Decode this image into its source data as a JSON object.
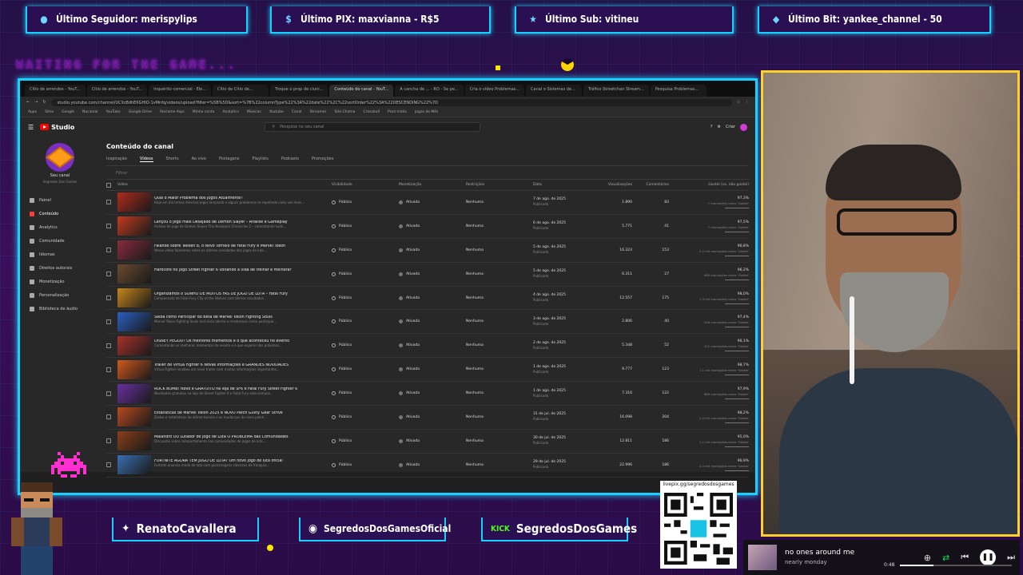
{
  "overlay": {
    "alerts": [
      {
        "icon": "user-icon",
        "text": "Último Seguidor: merispylips"
      },
      {
        "icon": "dollar-icon",
        "text": "Último PIX: maxvianna - R$5"
      },
      {
        "icon": "star-icon",
        "text": "Último Sub: vitineu"
      },
      {
        "icon": "diamond-icon",
        "text": "Último Bit: yankee_channel - 50"
      }
    ],
    "waiting": "WAITING FOR THE GAME...",
    "accent": "#1ad0ff",
    "cam_border": "#ffd02a"
  },
  "browser": {
    "tabs": [
      "Cítio de arrendos - YouT...",
      "Cítio de arrendos - YouT...",
      "Inquérito comercial - Ele...",
      "Cítio de Cítio de...",
      "Troque o prop de ciuni...",
      "Conteúdo do canal - YouT...",
      "A cancha de ... - RO - Se pe...",
      "Cria o vídeo Problemas...",
      "Canal o Sistemas de...",
      "Tráfico Streetchan Stream...",
      "Pesquisa Problemas..."
    ],
    "active_tab": 5,
    "url": "studio.youtube.com/channel/UCXz8dhEKGHIO-1vMnfq/videos/upload?filter=%5B%5D&sort=%7B%22columnType%22%3A%22date%22%2C%22sortOrder%22%3A%22DESCENDING%22%7D",
    "bookmarks": [
      "Apps",
      "Sites",
      "Google",
      "Nacional",
      "YouTube",
      "Google Drive",
      "Reclame Aqui",
      "Minha conta",
      "Analytics",
      "Músicas",
      "Youtube",
      "Canal",
      "Streamer",
      "Site Chama",
      "Crossbull",
      "Prod mídia",
      "Jogos do Mês"
    ]
  },
  "studio": {
    "logo": "Studio",
    "search_placeholder": "Pesquise no seu canal",
    "create_label": "Criar",
    "channel_name": "Seu canal",
    "channel_sub": "Segredos Dos Games",
    "sidebar": [
      "Painel",
      "Conteúdo",
      "Analytics",
      "Comunidade",
      "Idiomas",
      "Direitos autorais",
      "Monetização",
      "Personalização",
      "Biblioteca de áudio"
    ],
    "sidebar_active": 1,
    "page_title": "Conteúdo do canal",
    "tabs": [
      "Inspiração",
      "Vídeos",
      "Shorts",
      "Ao vivo",
      "Postagens",
      "Playlists",
      "Podcasts",
      "Promoções"
    ],
    "tabs_active": 1,
    "filter": "Filtrar",
    "columns": [
      "Vídeo",
      "Visibilidade",
      "Monetização",
      "Restrições",
      "Data",
      "Visualizações",
      "Comentários",
      "Gostei (vs. não gostei)"
    ],
    "rows": [
      {
        "title": "Qual o Maior Problema dos Jogos Atualmente?",
        "desc": "Hoje em dia temos diversos jogos lançando e alguns problemas se repetindo cada vez mais...",
        "vis": "Público",
        "mon": "Ativada",
        "res": "Nenhuma",
        "date": "7 de ago. de 2025",
        "status": "Publicado",
        "views": "1.890",
        "comments": "83",
        "like": "97,3%",
        "likes": "7 marcações como 'Gostei'",
        "thumb": "#b02a1c"
      },
      {
        "title": "Lançou o Jogo mais Desejado de Demon Slayer – Análise e Gameplay",
        "desc": "Análise do jogo de Demon Slayer The Hinokami Chronicles 2 – comentando tudo...",
        "vis": "Público",
        "mon": "Ativada",
        "res": "Nenhuma",
        "date": "6 de ago. de 2025",
        "status": "Publicado",
        "views": "5.771",
        "comments": "41",
        "like": "97,5%",
        "likes": "7 marcações como 'Gostei'",
        "thumb": "#c23b1f"
      },
      {
        "title": "Falando sobre Tekken 8, o Novo Torneio de Fatal Fury e Marvel Tokon",
        "desc": "Nesse vídeo falaremos sobre as últimas novidades dos jogos de luta...",
        "vis": "Público",
        "mon": "Ativada",
        "res": "Nenhuma",
        "date": "5 de ago. de 2025",
        "status": "Publicado",
        "views": "16.323",
        "comments": "153",
        "like": "96,8%",
        "likes": "2.2 mil marcações como 'Gostei'",
        "thumb": "#8a2b3c"
      },
      {
        "title": "Hardcore no jogo Street Fighter 6 voltando a vida de treinar e melhorar",
        "desc": "",
        "vis": "Público",
        "mon": "Ativada",
        "res": "Nenhuma",
        "date": "5 de ago. de 2025",
        "status": "Publicado",
        "views": "6.311",
        "comments": "27",
        "like": "96,2%",
        "likes": "480 marcações como 'Gostei'",
        "thumb": "#6b4a2f"
      },
      {
        "title": "Organizamos o SONHO DE MUITOS FÃS DE JOGO DE LUTA – Fatal Fury",
        "desc": "Campeonato de Fatal Fury City of the Wolves com ótimos resultados...",
        "vis": "Público",
        "mon": "Ativada",
        "res": "Nenhuma",
        "date": "4 de ago. de 2025",
        "status": "Publicado",
        "views": "12.557",
        "comments": "175",
        "like": "98,0%",
        "likes": "1.3 mil marcações como 'Gostei'",
        "thumb": "#c7861b"
      },
      {
        "title": "Saiba como Participar do Beta de Marvel Tokon Fighting Souls",
        "desc": "Marvel Tokon Fighting Souls terá beta aberto e mostramos como participar...",
        "vis": "Público",
        "mon": "Ativada",
        "res": "Nenhuma",
        "date": "3 de ago. de 2025",
        "status": "Publicado",
        "views": "2.806",
        "comments": "40",
        "like": "97,4%",
        "likes": "248 marcações como 'Gostei'",
        "thumb": "#2a5fc1"
      },
      {
        "title": "DISNEY PEGOU? Os melhores momentos e o que aconteceu no evento",
        "desc": "Comentando os melhores momentos do evento e o que esperar dos próximos...",
        "vis": "Público",
        "mon": "Ativada",
        "res": "Nenhuma",
        "date": "2 de ago. de 2025",
        "status": "Publicado",
        "views": "5.348",
        "comments": "52",
        "like": "96,1%",
        "likes": "412 marcações como 'Gostei'",
        "thumb": "#a8322b"
      },
      {
        "title": "Trailer de Virtua Fighter 6 Novas Informações e GRANDES NOVIDADES",
        "desc": "Virtua Fighter recebeu um novo trailer com muitas informações importantes...",
        "vis": "Público",
        "mon": "Ativada",
        "res": "Nenhuma",
        "date": "1 de ago. de 2025",
        "status": "Publicado",
        "views": "9.777",
        "comments": "123",
        "like": "98,7%",
        "likes": "1.1 mil marcações como 'Gostei'",
        "thumb": "#d1581c"
      },
      {
        "title": "ROCK BOMB! Novo e GRATUITO na loja de SF6 e Fatal Fury Street Fighter 6",
        "desc": "Novidades gratuitas na loja de Street Fighter 6 e Fatal Fury esta semana...",
        "vis": "Público",
        "mon": "Ativada",
        "res": "Nenhuma",
        "date": "1 de ago. de 2025",
        "status": "Publicado",
        "views": "7.316",
        "comments": "122",
        "like": "97,9%",
        "likes": "889 marcações como 'Gostei'",
        "thumb": "#6a2fa1"
      },
      {
        "title": "Estatísticas de Marvel Tokon 2025 e NOVO Patch Guilty Gear Strive",
        "desc": "Dados e estatísticas do último torneio e as mudanças do novo patch...",
        "vis": "Público",
        "mon": "Ativada",
        "res": "Nenhuma",
        "date": "31 de jul. de 2025",
        "status": "Publicado",
        "views": "16.098",
        "comments": "204",
        "like": "98,2%",
        "likes": "2.0 mil marcações como 'Gostei'",
        "thumb": "#b84a1f"
      },
      {
        "title": "Malandro OU Lutador de Jogo de Luta O PROBLEMA das Comunidades",
        "desc": "Discussão sobre comportamento nas comunidades de jogos de luta...",
        "vis": "Público",
        "mon": "Ativada",
        "res": "Nenhuma",
        "date": "30 de jul. de 2025",
        "status": "Publicado",
        "views": "12.811",
        "comments": "186",
        "like": "95,0%",
        "likes": "1.1 mil marcações como 'Gostei'",
        "thumb": "#8a3f1a"
      },
      {
        "title": "FORTNITE AGORA TEM JOGO DE LUTA? Um novo jogo de luta oficial",
        "desc": "Fortnite anuncia modo de luta com personagens clássicos da franquia...",
        "vis": "Público",
        "mon": "Ativada",
        "res": "Nenhuma",
        "date": "29 de jul. de 2025",
        "status": "Publicado",
        "views": "22.996",
        "comments": "186",
        "like": "96,9%",
        "likes": "2.4 mil marcações como 'Gostei'",
        "thumb": "#3a6fb2"
      }
    ]
  },
  "bottom": {
    "socials": [
      {
        "icon": "twitter-icon",
        "label": "RenatoCavallera"
      },
      {
        "icon": "instagram-icon",
        "label": "SegredosDosGamesOficial"
      },
      {
        "icon": "kick-icon",
        "label": "SegredosDosGames"
      }
    ],
    "qr_label": "livepix.gg/segredosdosgames",
    "music": {
      "title": "no ones around me",
      "artist": "nearly monday",
      "time": "0:48",
      "progress": 0.3
    }
  }
}
